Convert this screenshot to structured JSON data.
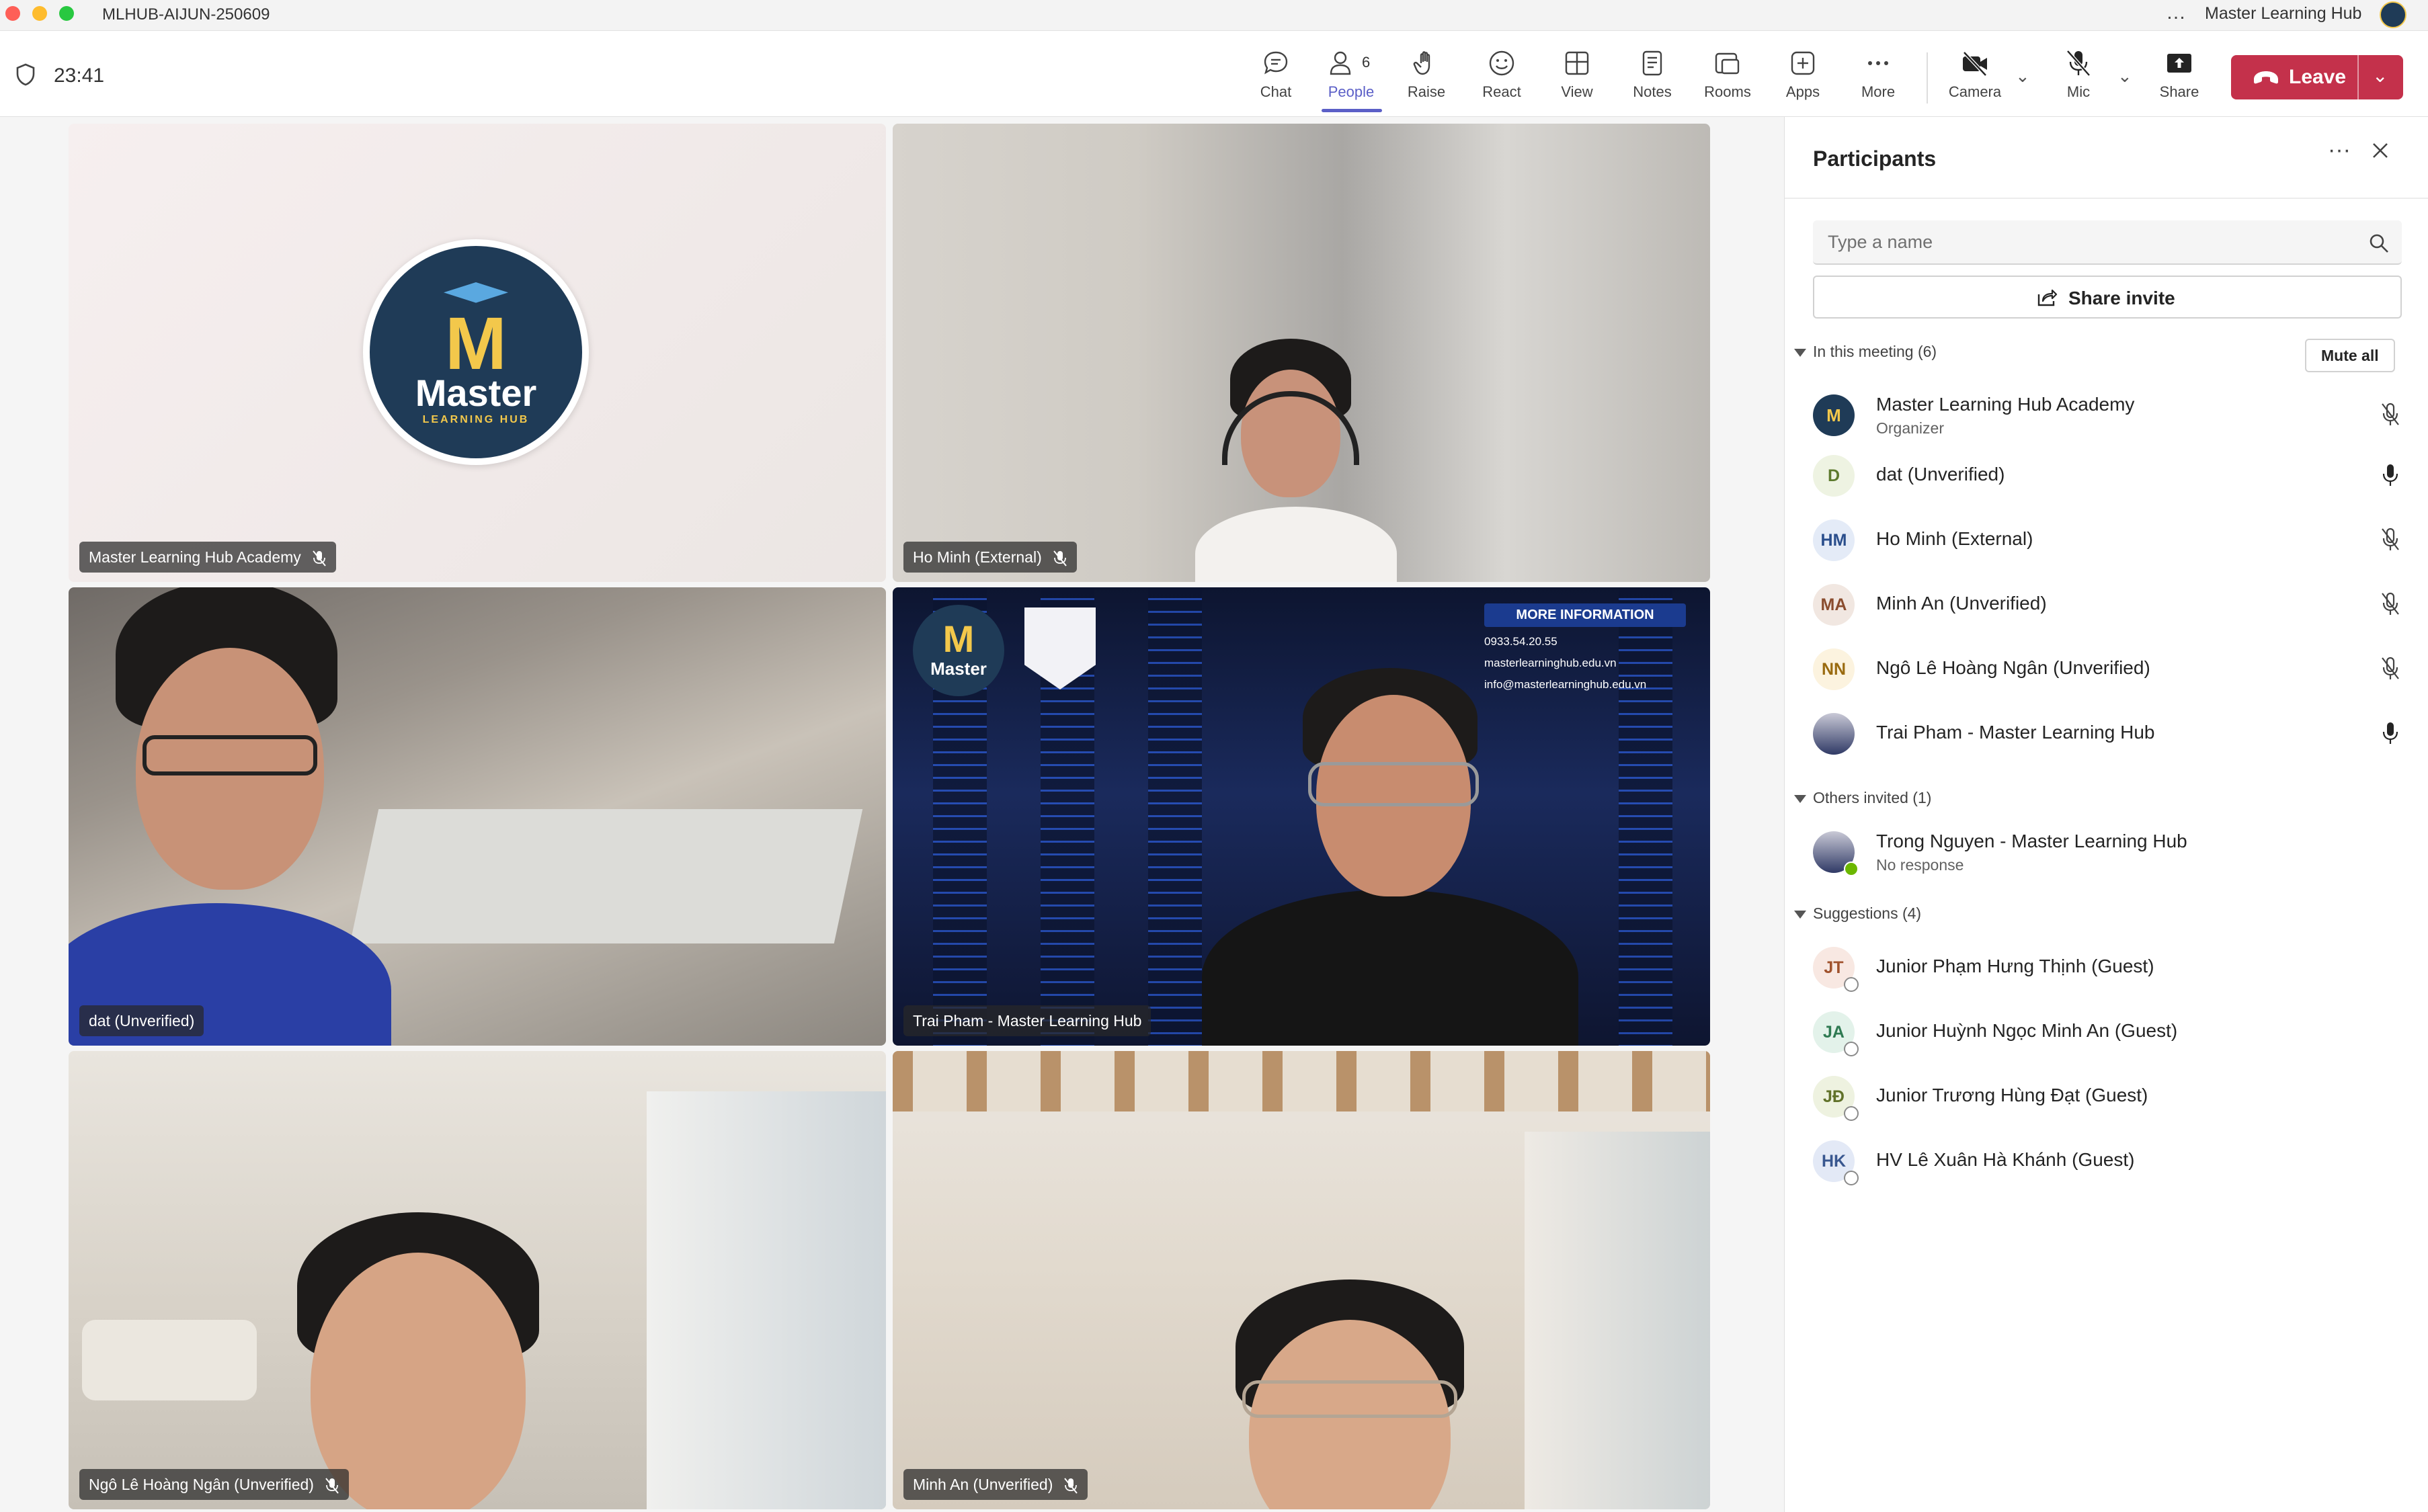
{
  "window": {
    "title": "MLHUB-AIJUN-250609",
    "user_name": "Master Learning Hub",
    "more_dots": "…"
  },
  "toolbar": {
    "timer": "23:41",
    "chat": "Chat",
    "people": "People",
    "people_count": "6",
    "raise": "Raise",
    "react": "React",
    "view": "View",
    "notes": "Notes",
    "rooms": "Rooms",
    "apps": "Apps",
    "more": "More",
    "camera": "Camera",
    "mic": "Mic",
    "share": "Share",
    "leave": "Leave",
    "chevron": "⌄"
  },
  "tiles": [
    {
      "name": "Master Learning Hub Academy",
      "muted": true
    },
    {
      "name": "Ho Minh (External)",
      "muted": true
    },
    {
      "name": "dat (Unverified)",
      "muted": false
    },
    {
      "name": "Trai Pham - Master Learning Hub",
      "muted": false
    },
    {
      "name": "Ngô Lê Hoàng Ngân (Unverified)",
      "muted": true
    },
    {
      "name": "Minh An (Unverified)",
      "muted": true
    }
  ],
  "logo": {
    "letter": "M",
    "word": "Master",
    "sub": "LEARNING HUB"
  },
  "background_info": {
    "title": "MORE INFORMATION",
    "phone": "0933.54.20.55",
    "web": "masterlearninghub.edu.vn",
    "email": "info@masterlearninghub.edu.vn"
  },
  "panel": {
    "title": "Participants",
    "more": "···",
    "search_placeholder": "Type a name",
    "share_invite": "Share invite",
    "mute_all": "Mute all",
    "in_meeting_label": "In this meeting (6)",
    "others_label": "Others invited (1)",
    "suggestions_label": "Suggestions (4)",
    "in_meeting": [
      {
        "initials": "M",
        "name": "Master Learning Hub Academy",
        "role": "Organizer",
        "mic": "off"
      },
      {
        "initials": "D",
        "name": "dat (Unverified)",
        "mic": "on"
      },
      {
        "initials": "HM",
        "name": "Ho Minh (External)",
        "mic": "off"
      },
      {
        "initials": "MA",
        "name": "Minh An (Unverified)",
        "mic": "off"
      },
      {
        "initials": "NN",
        "name": "Ngô Lê Hoàng Ngân (Unverified)",
        "mic": "off"
      },
      {
        "initials": "",
        "name": "Trai Pham - Master Learning Hub",
        "mic": "on"
      }
    ],
    "others": [
      {
        "name": "Trong Nguyen - Master Learning Hub",
        "status": "No response"
      }
    ],
    "suggestions": [
      {
        "initials": "JT",
        "name": "Junior Phạm Hưng Thịnh (Guest)"
      },
      {
        "initials": "JA",
        "name": "Junior Huỳnh Ngọc Minh An (Guest)"
      },
      {
        "initials": "JĐ",
        "name": "Junior Trương Hùng Đạt (Guest)"
      },
      {
        "initials": "HK",
        "name": "HV Lê Xuân Hà Khánh (Guest)"
      }
    ]
  }
}
